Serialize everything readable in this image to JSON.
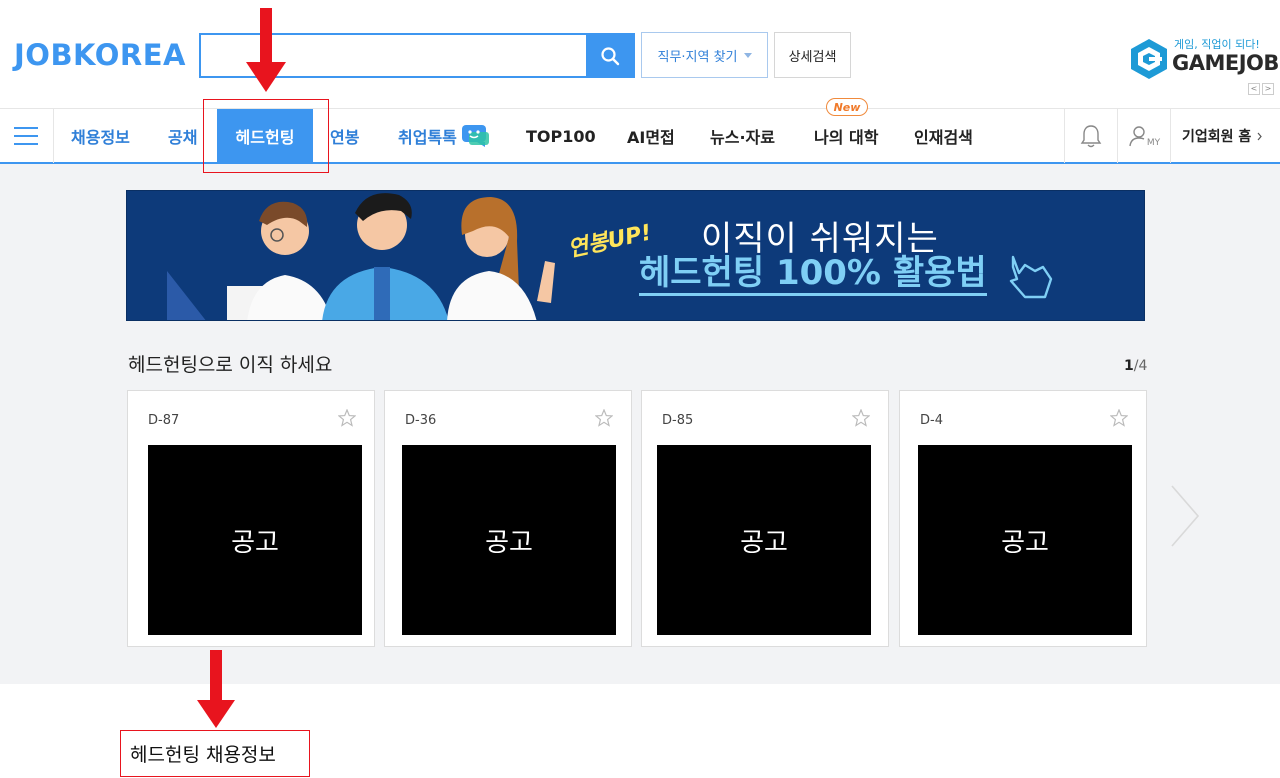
{
  "header": {
    "logo": "JOBKOREA",
    "search": {
      "value": "",
      "placeholder": ""
    },
    "job_region_button": "직무·지역 찾기",
    "detail_search_button": "상세검색",
    "gamejob": {
      "tagline": "게임, 직업이 되다!",
      "wordmark": "GAMEJOB",
      "prev": "<",
      "next": ">"
    }
  },
  "nav": {
    "items": [
      {
        "label": "채용정보"
      },
      {
        "label": "공채"
      },
      {
        "label": "헤드헌팅"
      },
      {
        "label": "연봉"
      },
      {
        "label": "취업톡톡"
      },
      {
        "label": "TOP100"
      },
      {
        "label": "AI면접"
      },
      {
        "label": "뉴스·자료"
      },
      {
        "label": "나의 대학"
      },
      {
        "label": "인재검색"
      }
    ],
    "new_badge": "New",
    "my_label": "MY",
    "biz_home": "기업회원 홈"
  },
  "banner": {
    "tag": "연봉UP!",
    "line1": "이직이 쉬워지는",
    "line2": "헤드헌팅 100% 활용법"
  },
  "section": {
    "title": "헤드헌팅으로 이직 하세요",
    "page_current": "1",
    "page_total": "/4",
    "cards": [
      {
        "dday": "D-87",
        "thumb": "공고"
      },
      {
        "dday": "D-36",
        "thumb": "공고"
      },
      {
        "dday": "D-85",
        "thumb": "공고"
      },
      {
        "dday": "D-4",
        "thumb": "공고"
      }
    ]
  },
  "annotation": {
    "caption": "헤드헌팅 채용정보"
  },
  "colors": {
    "brand_blue": "#3d96f0",
    "annotation_red": "#e8141e",
    "banner_navy": "#0d3a7a"
  }
}
